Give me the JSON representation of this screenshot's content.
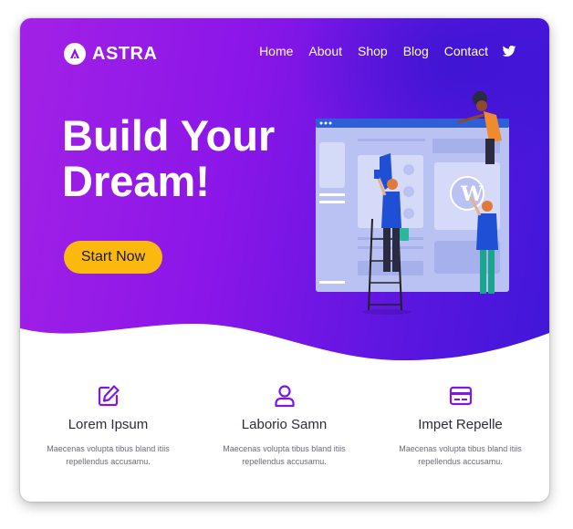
{
  "brand": {
    "name": "ASTRA",
    "accent": "#fbb80e",
    "primary": "#8a16e8"
  },
  "nav": {
    "items": [
      "Home",
      "About",
      "Shop",
      "Blog",
      "Contact"
    ],
    "social_icon": "twitter-icon"
  },
  "hero": {
    "headline_line1": "Build Your",
    "headline_line2": "Dream!",
    "cta_label": "Start Now",
    "illustration": "website-builders-illustration"
  },
  "features": [
    {
      "icon": "edit-icon",
      "title": "Lorem Ipsum",
      "text": "Maecenas volupta tibus bland itiis repellendus accusamu."
    },
    {
      "icon": "user-icon",
      "title": "Laborio Samn",
      "text": "Maecenas volupta tibus bland itiis repellendus accusamu."
    },
    {
      "icon": "credit-card-icon",
      "title": "Impet Repelle",
      "text": "Maecenas volupta tibus bland itiis repellendus accusamu."
    }
  ]
}
